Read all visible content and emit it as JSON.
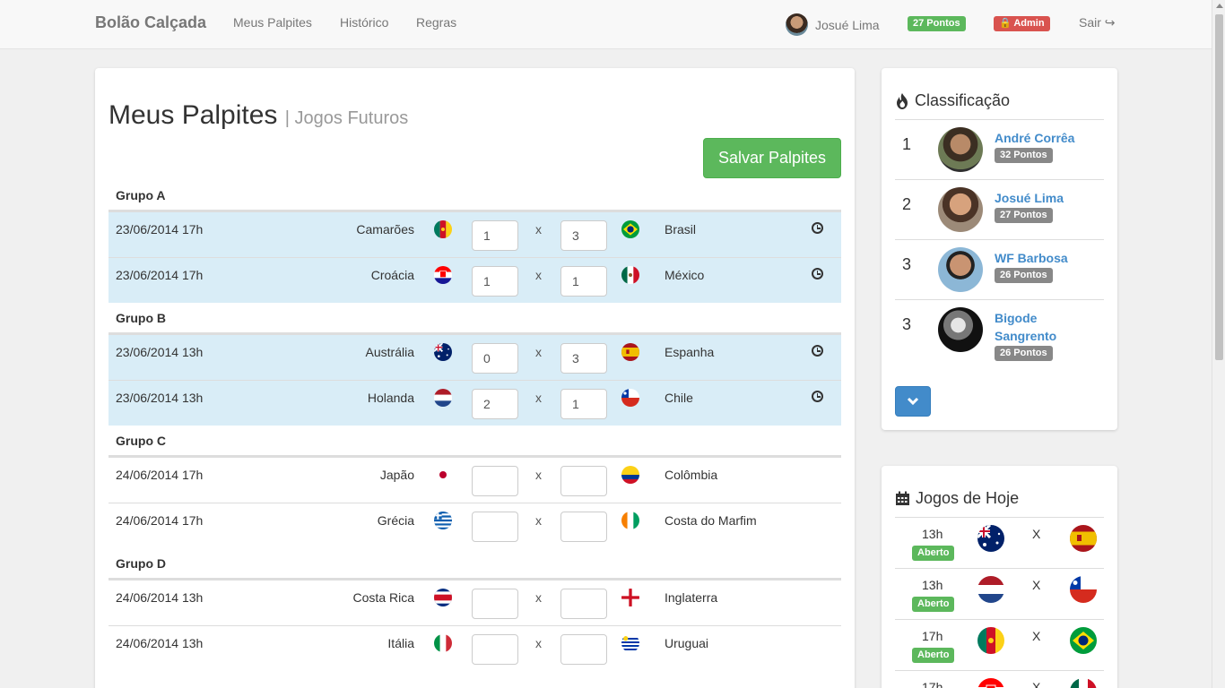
{
  "navbar": {
    "brand": "Bolão Calçada",
    "links": [
      "Meus Palpites",
      "Histórico",
      "Regras"
    ],
    "user_name": "Josué Lima",
    "points_badge": "27 Pontos",
    "admin_badge": "Admin",
    "logout": "Sair"
  },
  "main": {
    "title": "Meus Palpites",
    "subtitle": "| Jogos Futuros",
    "save_button": "Salvar Palpites",
    "x_label": "x",
    "groups": [
      {
        "name": "Grupo A",
        "matches": [
          {
            "date": "23/06/2014 17h",
            "home": "Camarões",
            "home_score": "1",
            "away_score": "3",
            "away": "Brasil",
            "locked": true
          },
          {
            "date": "23/06/2014 17h",
            "home": "Croácia",
            "home_score": "1",
            "away_score": "1",
            "away": "México",
            "locked": true
          }
        ]
      },
      {
        "name": "Grupo B",
        "matches": [
          {
            "date": "23/06/2014 13h",
            "home": "Austrália",
            "home_score": "0",
            "away_score": "3",
            "away": "Espanha",
            "locked": true
          },
          {
            "date": "23/06/2014 13h",
            "home": "Holanda",
            "home_score": "2",
            "away_score": "1",
            "away": "Chile",
            "locked": true
          }
        ]
      },
      {
        "name": "Grupo C",
        "matches": [
          {
            "date": "24/06/2014 17h",
            "home": "Japão",
            "home_score": "",
            "away_score": "",
            "away": "Colômbia",
            "locked": false
          },
          {
            "date": "24/06/2014 17h",
            "home": "Grécia",
            "home_score": "",
            "away_score": "",
            "away": "Costa do Marfim",
            "locked": false
          }
        ]
      },
      {
        "name": "Grupo D",
        "matches": [
          {
            "date": "24/06/2014 13h",
            "home": "Costa Rica",
            "home_score": "",
            "away_score": "",
            "away": "Inglaterra",
            "locked": false
          },
          {
            "date": "24/06/2014 13h",
            "home": "Itália",
            "home_score": "",
            "away_score": "",
            "away": "Uruguai",
            "locked": false
          }
        ]
      }
    ]
  },
  "ranking": {
    "title": "Classificação",
    "items": [
      {
        "pos": "1",
        "name": "André Corrêa",
        "points": "32 Pontos"
      },
      {
        "pos": "2",
        "name": "Josué Lima",
        "points": "27 Pontos"
      },
      {
        "pos": "3",
        "name": "WF Barbosa",
        "points": "26 Pontos"
      },
      {
        "pos": "3",
        "name": "Bigode Sangrento",
        "points": "26 Pontos"
      }
    ]
  },
  "today": {
    "title": "Jogos de Hoje",
    "x_label": "X",
    "games": [
      {
        "time": "13h",
        "status": "Aberto"
      },
      {
        "time": "13h",
        "status": "Aberto"
      },
      {
        "time": "17h",
        "status": "Aberto"
      },
      {
        "time": "17h",
        "status": ""
      }
    ]
  },
  "colors": {
    "accent": "#428bca",
    "success": "#5cb85c",
    "danger": "#d9534f",
    "info_row": "#d9edf7"
  }
}
